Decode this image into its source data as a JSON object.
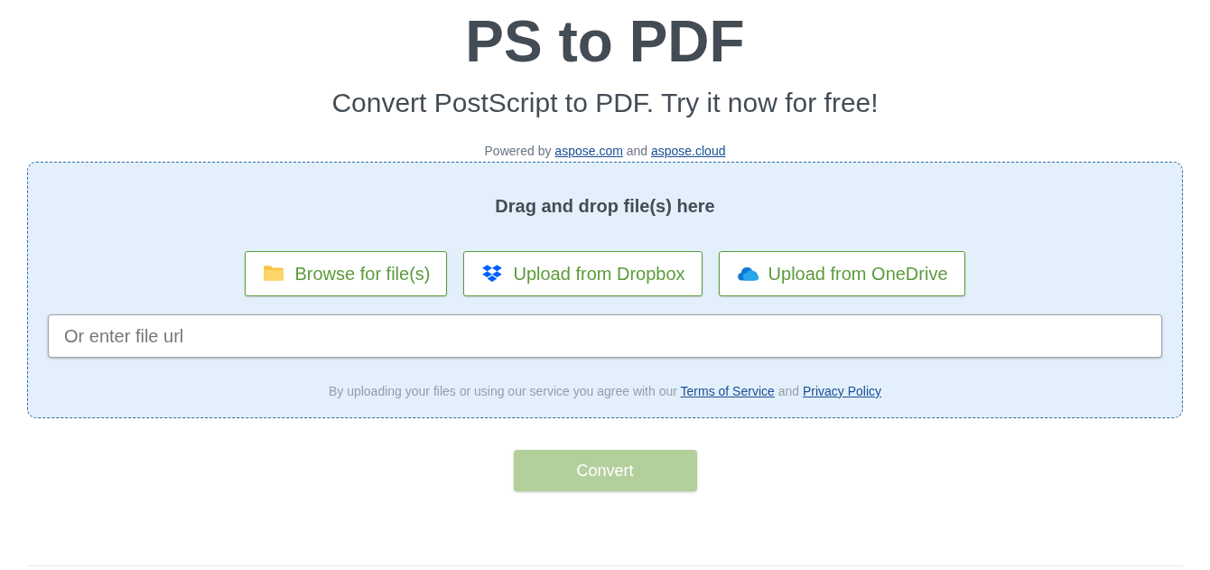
{
  "title": "PS to PDF",
  "subtitle": "Convert PostScript to PDF. Try it now for free!",
  "powered_by": [
    {
      "kind": "text",
      "text": "Powered by"
    },
    {
      "kind": "link",
      "text": "aspose.com"
    },
    {
      "kind": "text",
      "text": "and"
    },
    {
      "kind": "link",
      "text": "aspose.cloud"
    }
  ],
  "drop_zone": {
    "heading": "Drag and drop file(s) here",
    "buttons": [
      {
        "kind": "folder",
        "label": "Browse for file(s)"
      },
      {
        "kind": "dropbox",
        "label": "Upload from Dropbox"
      },
      {
        "kind": "onedrive",
        "label": "Upload from OneDrive"
      }
    ],
    "url_field": {
      "placeholder": "Or enter file url"
    },
    "terms": [
      {
        "kind": "text",
        "text": "By uploading your files or using our service you agree with our"
      },
      {
        "kind": "link",
        "text": "Terms of Service"
      },
      {
        "kind": "text",
        "text": "and"
      },
      {
        "kind": "link",
        "text": "Privacy Policy"
      }
    ]
  },
  "convert_button": {
    "label": "Convert",
    "disabled": true
  }
}
